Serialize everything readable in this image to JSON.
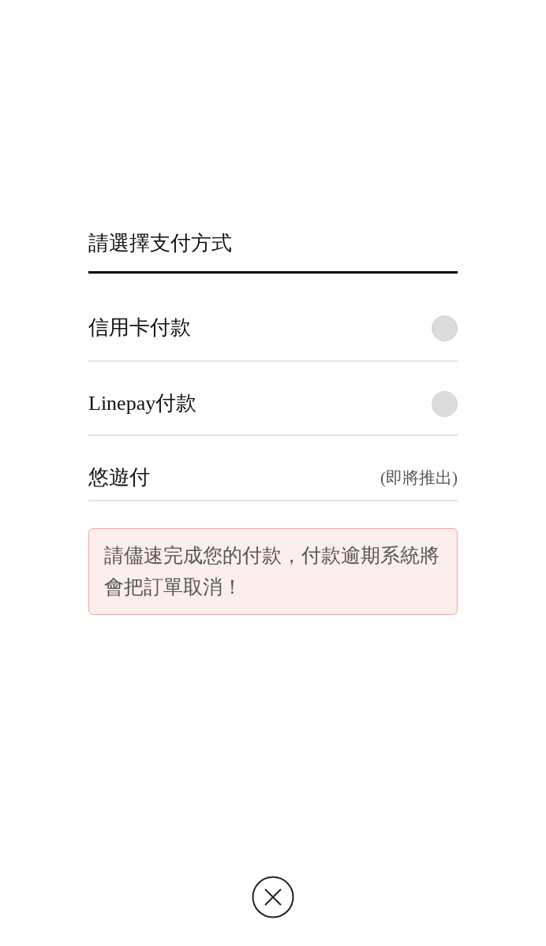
{
  "title": "請選擇支付方式",
  "payment_methods": [
    {
      "kind": "radio",
      "label": "信用卡付款",
      "selected": false
    },
    {
      "kind": "radio",
      "label": "Linepay付款",
      "selected": false
    },
    {
      "kind": "note",
      "label": "悠遊付",
      "note": "(即將推出)"
    }
  ],
  "alert": {
    "text": "請儘速完成您的付款，付款逾期系統將會把訂單取消！"
  }
}
